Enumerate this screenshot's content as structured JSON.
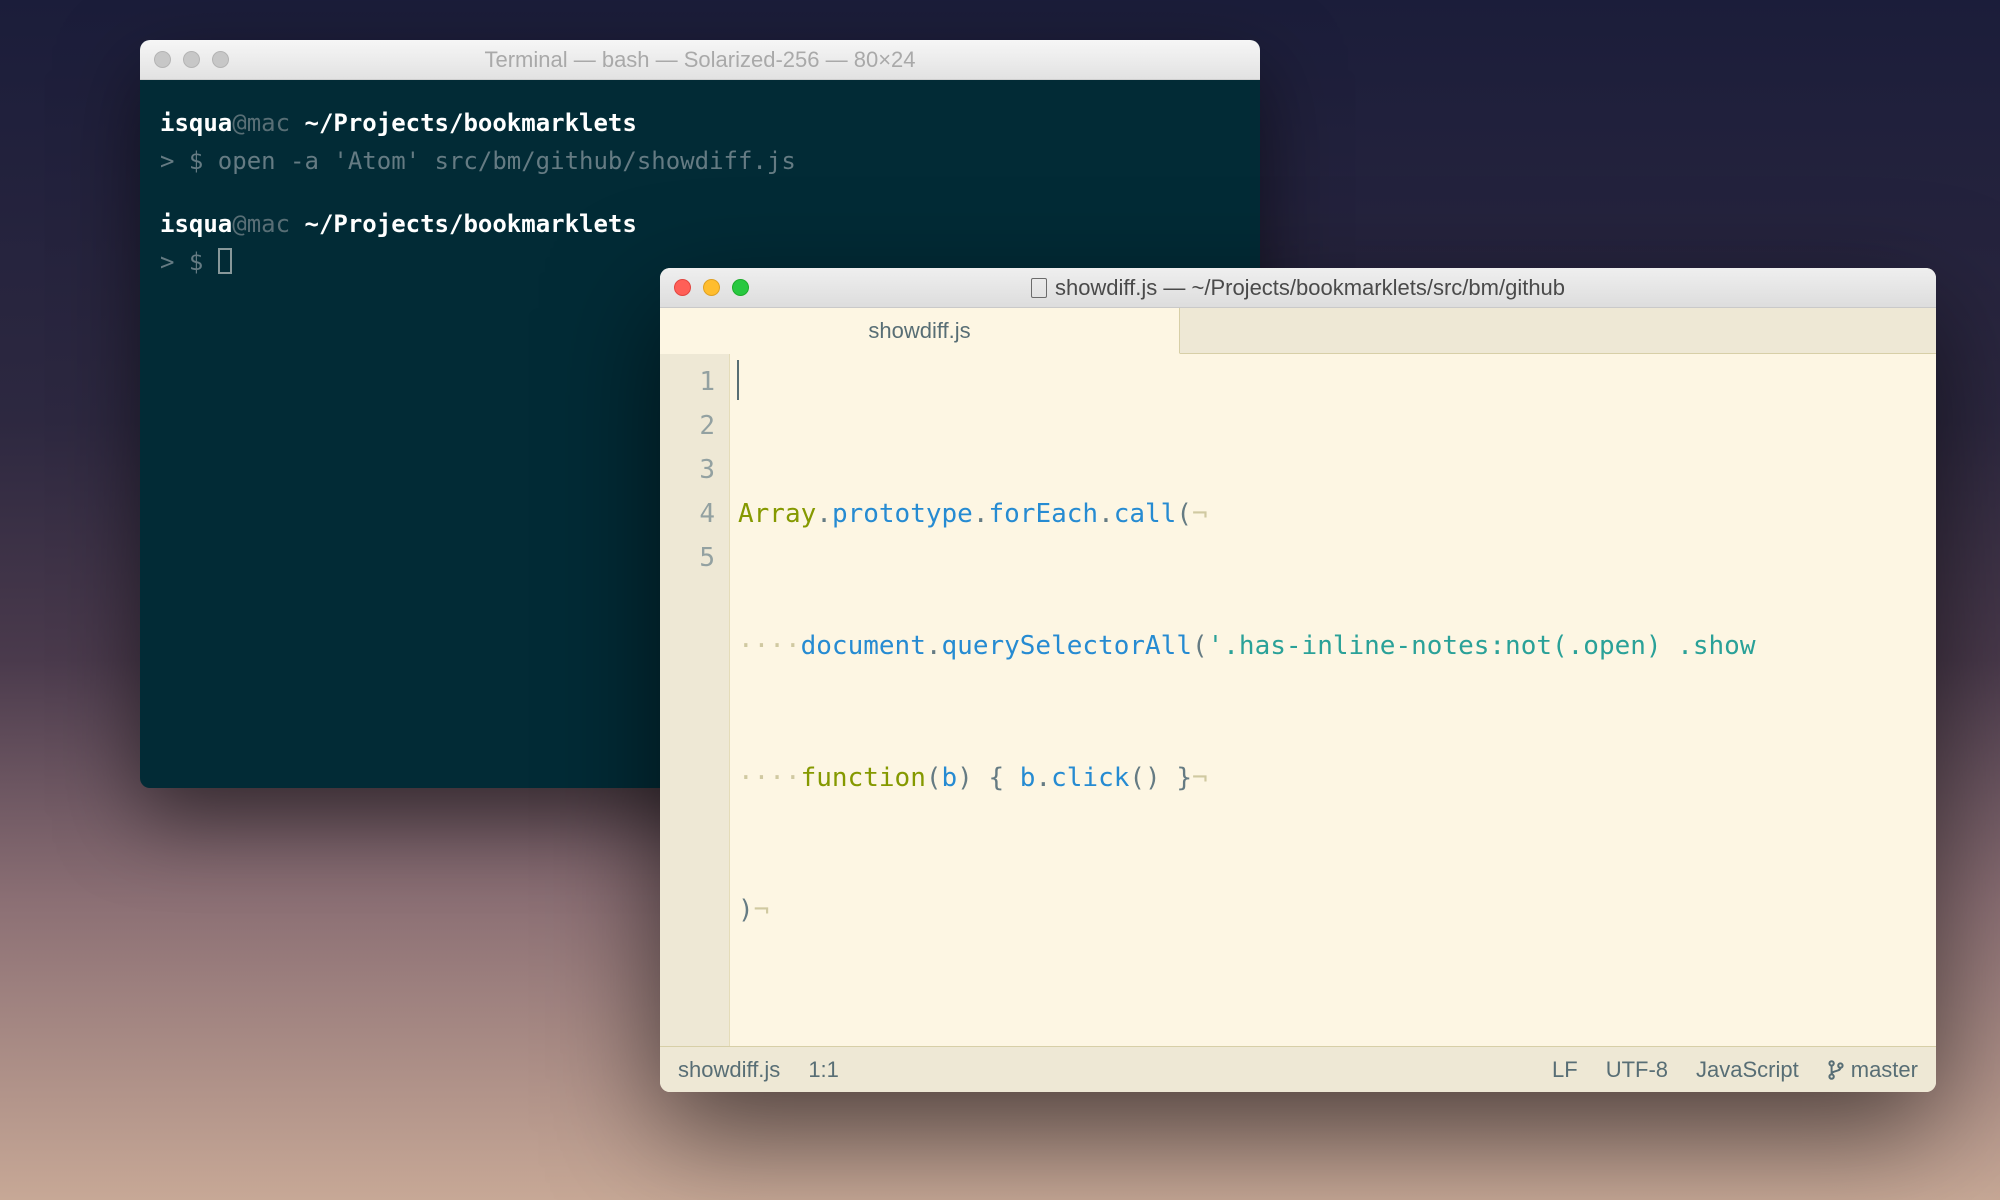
{
  "terminal": {
    "title": "Terminal — bash — Solarized-256 — 80×24",
    "prompt1_user": "isqua",
    "prompt1_at": "@mac ",
    "prompt1_path": "~/Projects/bookmarklets",
    "prompt1_sign": "> $ ",
    "prompt1_cmd": "open -a 'Atom' src/bm/github/showdiff.js",
    "prompt2_user": "isqua",
    "prompt2_at": "@mac ",
    "prompt2_path": "~/Projects/bookmarklets",
    "prompt2_sign": "> $ "
  },
  "editor": {
    "title": "showdiff.js — ~/Projects/bookmarklets/src/bm/github",
    "tab_label": "showdiff.js",
    "line_numbers": [
      "1",
      "2",
      "3",
      "4",
      "5"
    ],
    "code": {
      "l1_a": "Array",
      "l1_b": ".",
      "l1_c": "prototype",
      "l1_d": ".",
      "l1_e": "forEach",
      "l1_f": ".",
      "l1_g": "call",
      "l1_h": "(",
      "l1_eol": "¬",
      "l2_ws": "····",
      "l2_a": "document",
      "l2_b": ".",
      "l2_c": "querySelectorAll",
      "l2_d": "(",
      "l2_e": "'.has-inline-notes:not(.open) .show",
      "l3_ws": "····",
      "l3_a": "function",
      "l3_b": "(",
      "l3_c": "b",
      "l3_d": ") { ",
      "l3_e": "b",
      "l3_f": ".",
      "l3_g": "click",
      "l3_h": "() }",
      "l3_eol": "¬",
      "l4_a": ")",
      "l4_eol": "¬"
    },
    "status": {
      "filename": "showdiff.js",
      "position": "1:1",
      "eol": "LF",
      "encoding": "UTF-8",
      "language": "JavaScript",
      "branch": "master"
    }
  }
}
